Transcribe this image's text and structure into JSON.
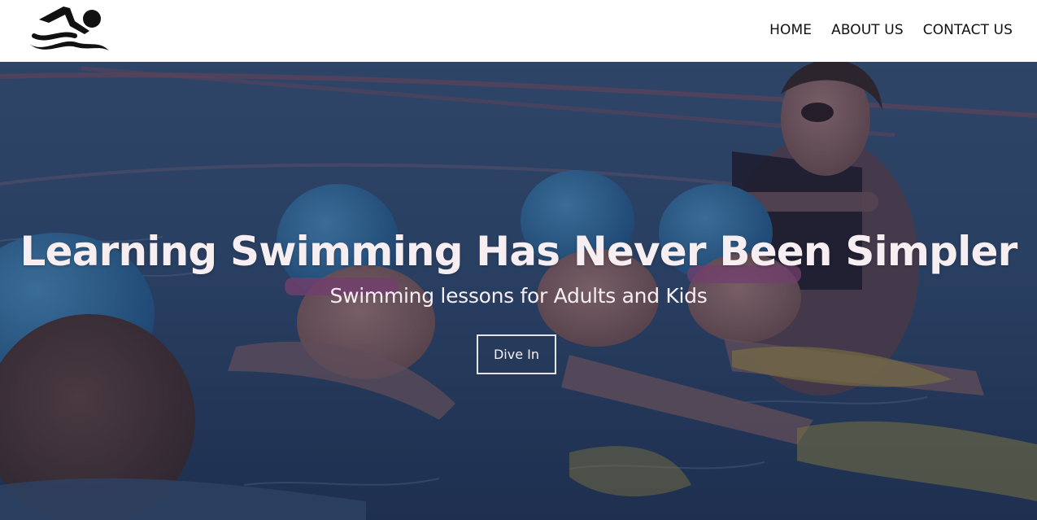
{
  "brand": {
    "logo_icon": "swimmer-icon"
  },
  "nav": {
    "items": [
      {
        "label": "HOME"
      },
      {
        "label": "ABOUT US"
      },
      {
        "label": "CONTACT US"
      }
    ]
  },
  "hero": {
    "title": "Learning Swimming Has Never Been Simpler",
    "subtitle": "Swimming lessons for Adults and Kids",
    "cta_label": "Dive In",
    "background_image": "photo of children learning to swim with an instructor in a pool",
    "overlay_color": "#1c223e"
  },
  "colors": {
    "header_bg": "#ffffff",
    "nav_text": "#111111",
    "hero_text": "#f6eef0",
    "button_border": "#e9e2e6"
  }
}
